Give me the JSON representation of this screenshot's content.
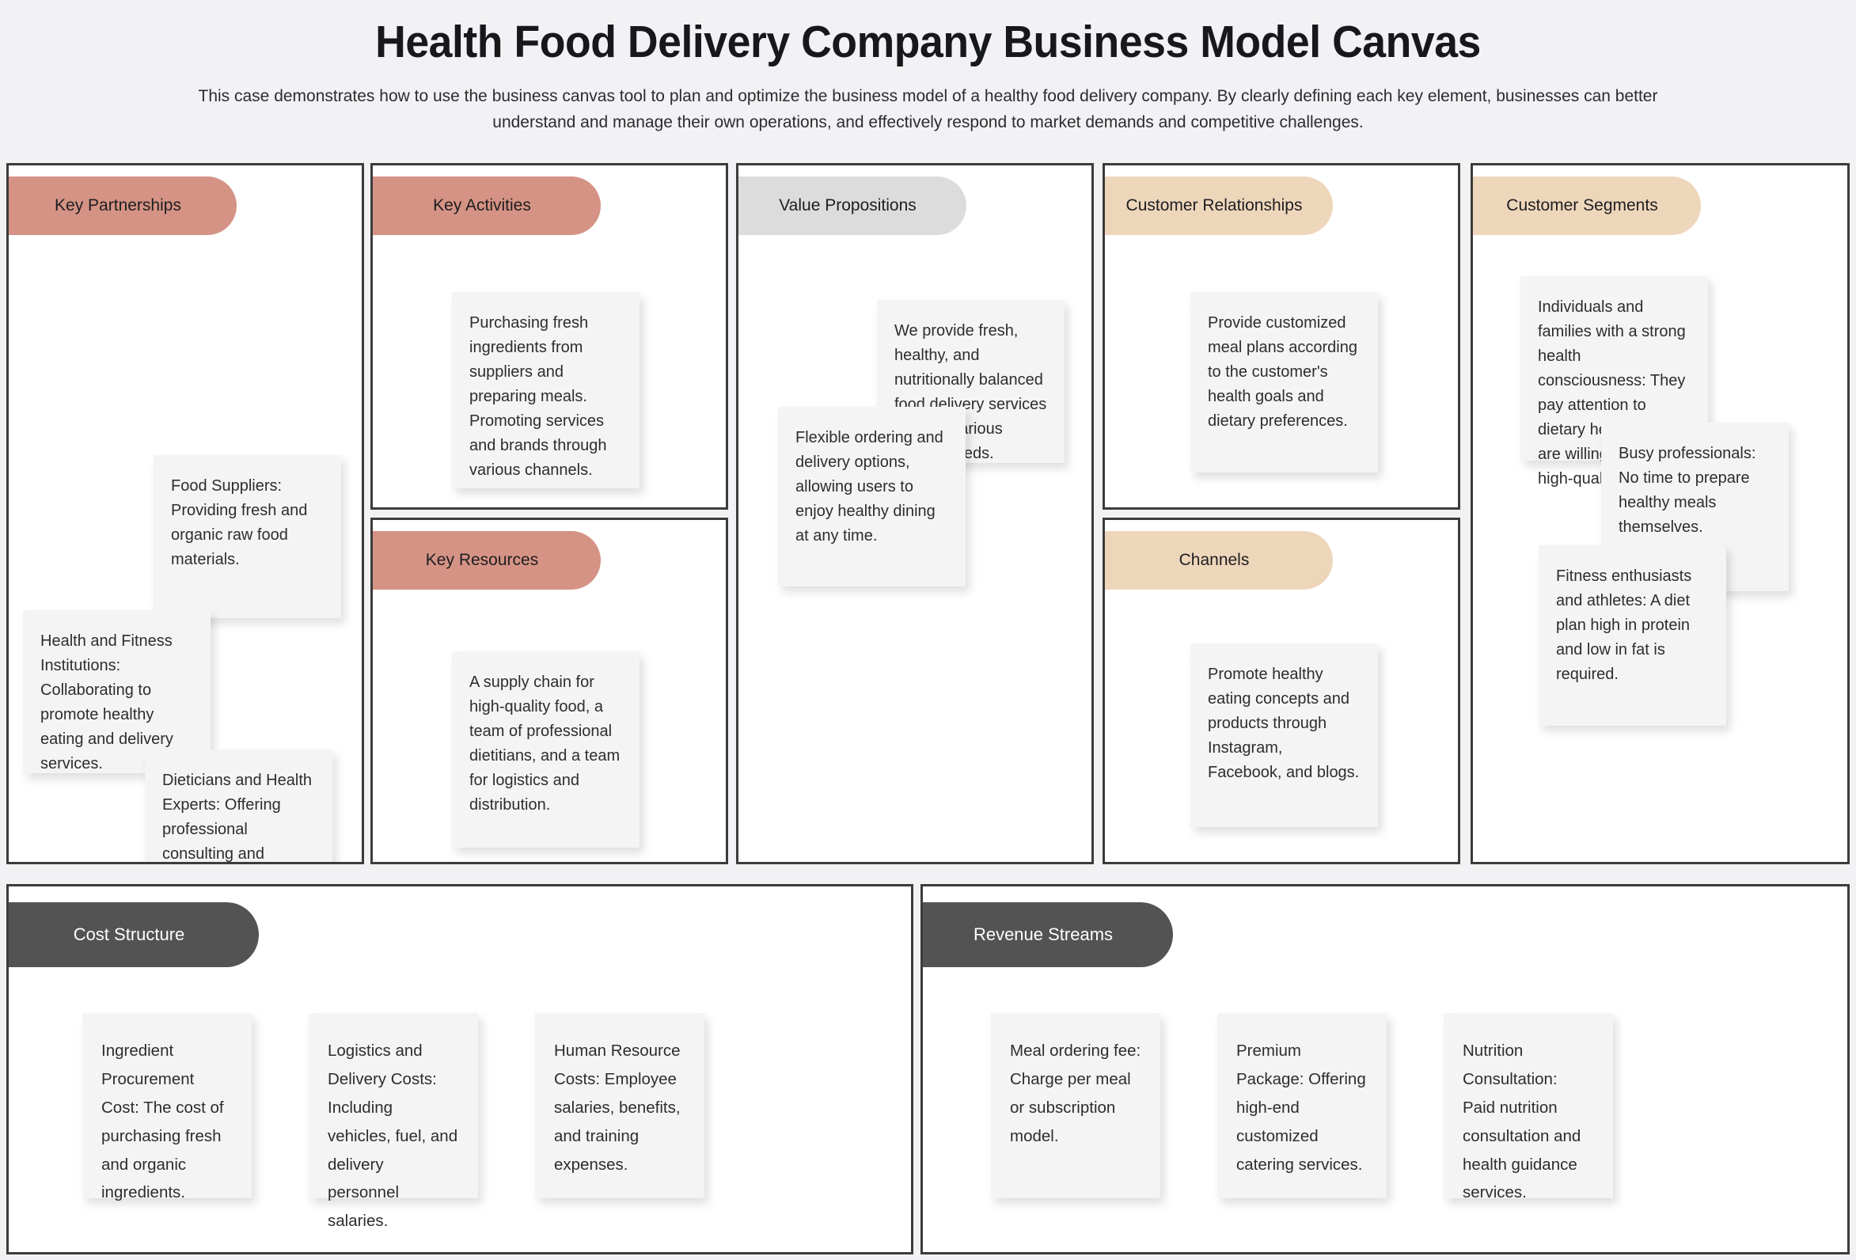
{
  "header": {
    "title": "Health Food Delivery Company Business Model Canvas",
    "subtitle": "This case demonstrates how to use the business canvas tool to plan and optimize the business model of a healthy food delivery company. By clearly defining each key element, businesses can better understand and manage their own operations, and effectively respond to market demands and competitive challenges."
  },
  "colors": {
    "pill_red": "#d59385",
    "pill_gray": "#dcdcdc",
    "pill_peach": "#eed6bb",
    "pill_dark": "#535353",
    "panel_border": "#3c3c3c",
    "note_bg": "#f4f4f4",
    "page_bg": "#f2f2f4"
  },
  "blocks": {
    "key_partnerships": {
      "title": "Key Partnerships",
      "notes": [
        "Food Suppliers: Providing fresh and organic raw food materials.",
        "Health and Fitness Institutions: Collaborating to promote healthy eating and delivery services.",
        "Dieticians and Health Experts: Offering professional consulting and dietary planning services."
      ]
    },
    "key_activities": {
      "title": "Key Activities",
      "notes": [
        "Purchasing fresh ingredients from suppliers and preparing meals. Promoting services and brands through various channels."
      ]
    },
    "key_resources": {
      "title": "Key Resources",
      "notes": [
        "A supply chain for high-quality food, a team of professional dietitians, and a team for logistics and distribution."
      ]
    },
    "value_propositions": {
      "title": "Value Propositions",
      "notes": [
        "We provide fresh, healthy, and nutritionally balanced food delivery services to meet various dietary needs.",
        "Flexible ordering and delivery options, allowing users to enjoy healthy dining at any time."
      ]
    },
    "customer_relationships": {
      "title": "Customer Relationships",
      "notes": [
        "Provide customized meal plans according to the customer's health goals and dietary preferences."
      ]
    },
    "channels": {
      "title": "Channels",
      "notes": [
        "Promote healthy eating concepts and products through Instagram, Facebook, and blogs."
      ]
    },
    "customer_segments": {
      "title": "Customer Segments",
      "notes": [
        "Individuals and families with a strong health consciousness: They pay attention to dietary health and are willing to pay for high-quality food.",
        "Busy professionals: No time to prepare healthy meals themselves.",
        "Fitness enthusiasts and athletes: A diet plan high in protein and low in fat is required."
      ]
    },
    "cost_structure": {
      "title": "Cost Structure",
      "notes": [
        "Ingredient Procurement Cost: The cost of purchasing fresh and organic ingredients.",
        "Logistics and Delivery Costs: Including vehicles, fuel, and delivery personnel salaries.",
        "Human Resource Costs: Employee salaries, benefits, and training expenses."
      ]
    },
    "revenue_streams": {
      "title": "Revenue Streams",
      "notes": [
        "Meal ordering fee: Charge per meal or subscription model.",
        "Premium Package: Offering high-end customized catering services.",
        "Nutrition Consultation: Paid nutrition consultation and health guidance services."
      ]
    }
  }
}
